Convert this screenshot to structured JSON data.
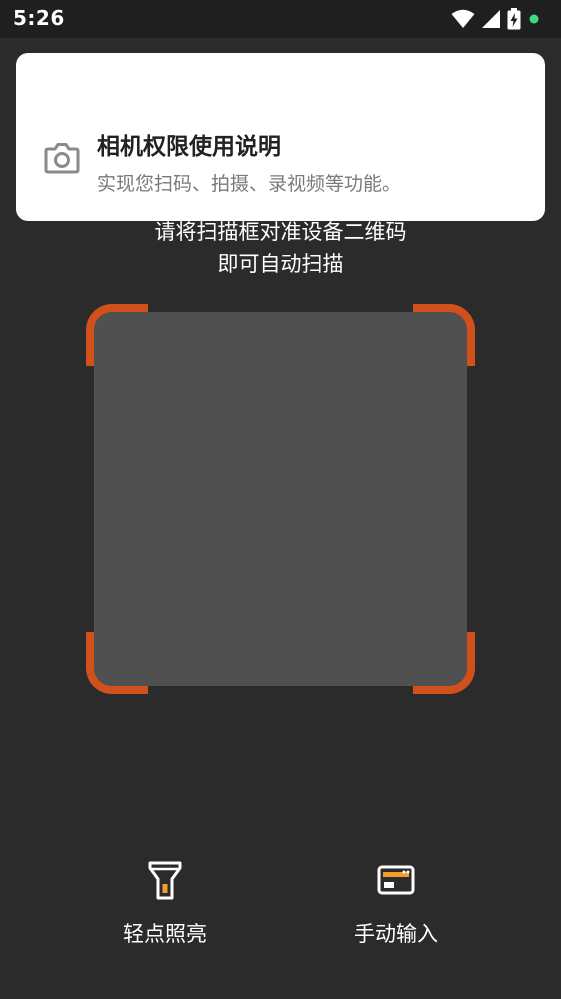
{
  "status_bar": {
    "time": "5:26",
    "icons": [
      "wifi-icon",
      "signal-icon",
      "battery-charging-icon",
      "notification-dot-icon"
    ],
    "dot_color": "#3ddc84"
  },
  "permission_card": {
    "icon": "camera-icon",
    "title": "相机权限使用说明",
    "description": "实现您扫码、拍摄、录视频等功能。"
  },
  "scanner": {
    "instruction_line1": "请将扫描框对准设备二维码",
    "instruction_line2": "即可自动扫描",
    "accent_color": "#d1511c"
  },
  "actions": {
    "flashlight": {
      "label": "轻点照亮",
      "icon": "flashlight-icon"
    },
    "manual_input": {
      "label": "手动输入",
      "icon": "card-input-icon"
    }
  }
}
